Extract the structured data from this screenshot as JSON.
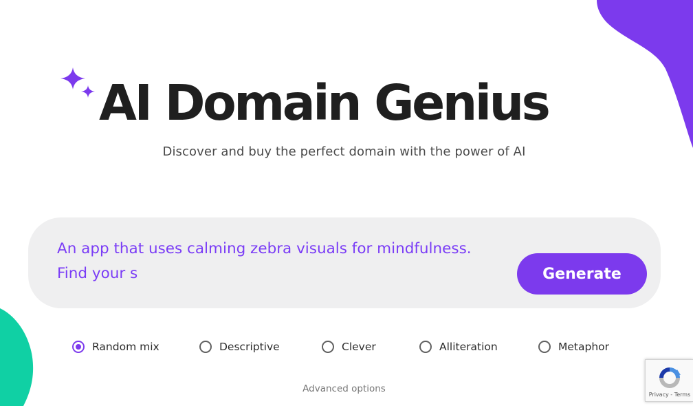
{
  "hero": {
    "title": "AI Domain Genius",
    "subtitle": "Discover and buy the perfect domain with the power of AI"
  },
  "search": {
    "prompt_value": "An app that uses calming zebra visuals for mindfulness. Find your s",
    "generate_label": "Generate"
  },
  "style_options": [
    {
      "label": "Random mix",
      "selected": true
    },
    {
      "label": "Descriptive",
      "selected": false
    },
    {
      "label": "Clever",
      "selected": false
    },
    {
      "label": "Alliteration",
      "selected": false
    },
    {
      "label": "Metaphor",
      "selected": false
    }
  ],
  "advanced_options_label": "Advanced options",
  "recaptcha": {
    "privacy_label": "Privacy",
    "separator": " - ",
    "terms_label": "Terms"
  },
  "colors": {
    "accent": "#7c3aed",
    "prompt_text": "#7a3cf6",
    "title_text": "#1f1f1f",
    "panel_background": "#efeff0",
    "blob_purple": "#7c3aed",
    "blob_green": "#10d0a4"
  },
  "icons": {
    "sparkle": "sparkle-icon",
    "recaptcha": "recaptcha-icon"
  }
}
